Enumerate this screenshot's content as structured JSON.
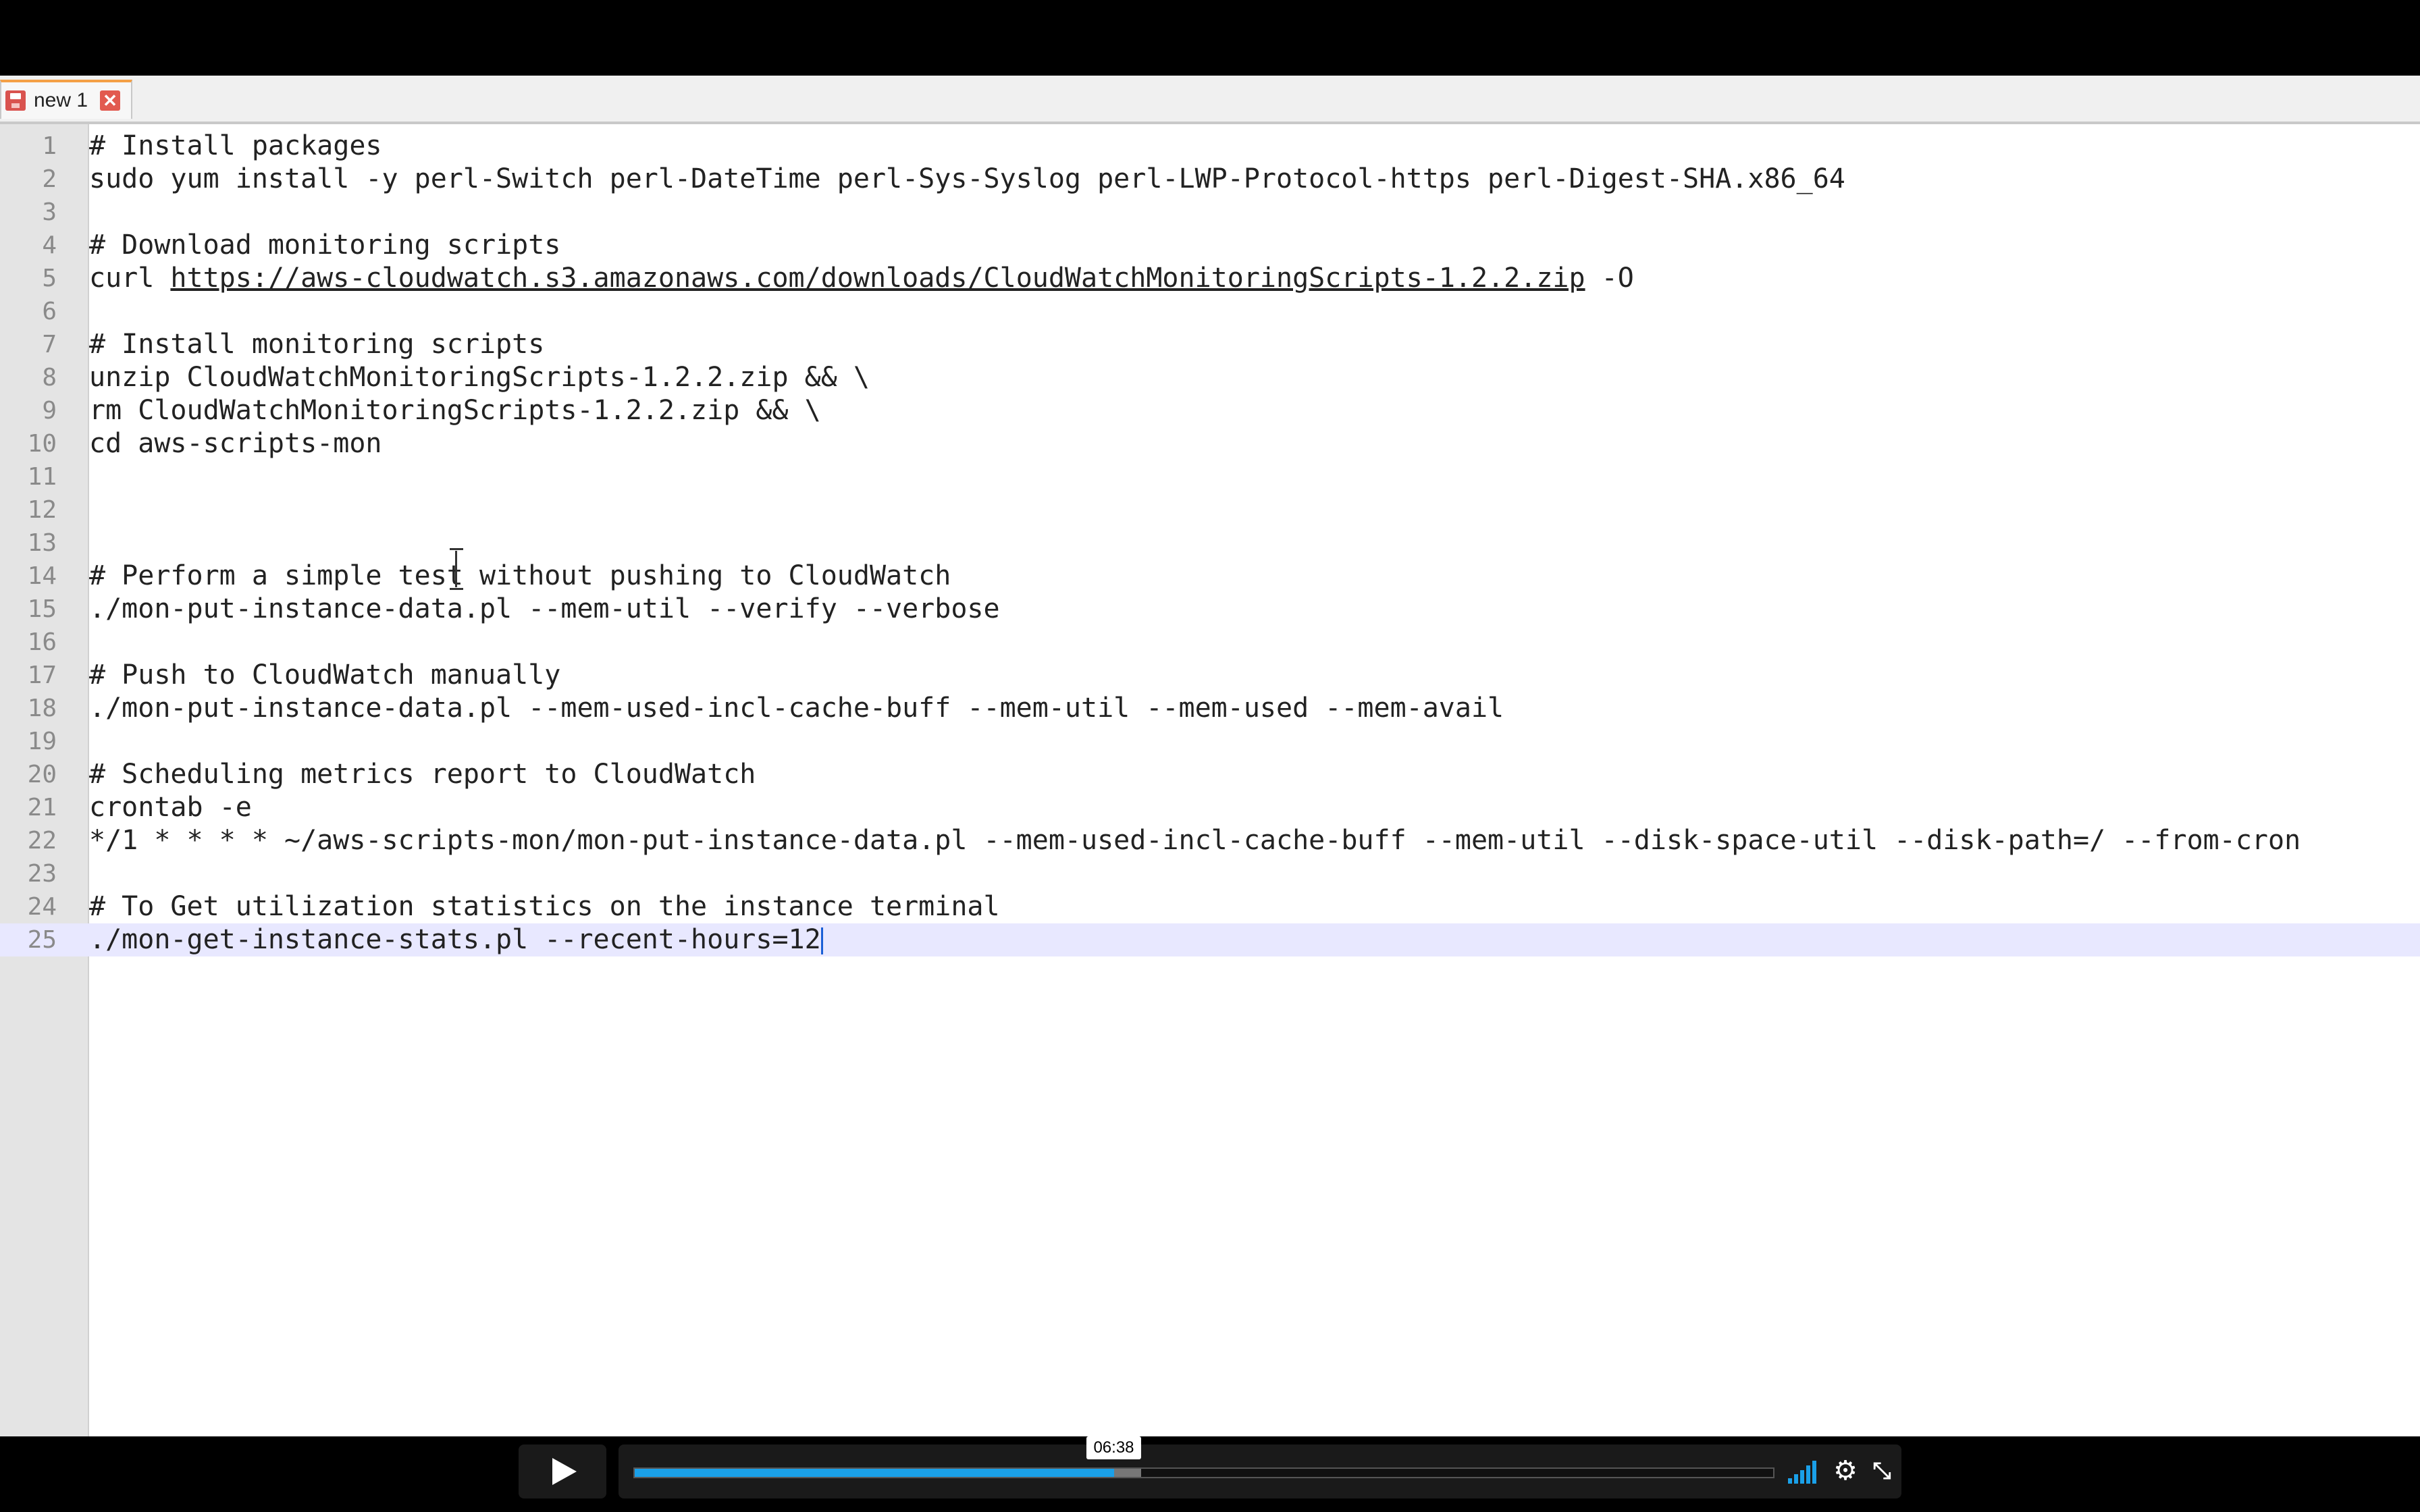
{
  "tab": {
    "label": "new 1",
    "close_glyph": "✕"
  },
  "lines": [
    {
      "num": "1",
      "text": "# Install packages"
    },
    {
      "num": "2",
      "text": "sudo yum install -y perl-Switch perl-DateTime perl-Sys-Syslog perl-LWP-Protocol-https perl-Digest-SHA.x86_64"
    },
    {
      "num": "3",
      "text": ""
    },
    {
      "num": "4",
      "text": "# Download monitoring scripts"
    },
    {
      "num": "5",
      "text": "curl ",
      "link": "https://aws-cloudwatch.s3.amazonaws.com/downloads/CloudWatchMonitoringScripts-1.2.2.zip",
      "after": " -O"
    },
    {
      "num": "6",
      "text": ""
    },
    {
      "num": "7",
      "text": "# Install monitoring scripts"
    },
    {
      "num": "8",
      "text": "unzip CloudWatchMonitoringScripts-1.2.2.zip && \\"
    },
    {
      "num": "9",
      "text": "rm CloudWatchMonitoringScripts-1.2.2.zip && \\"
    },
    {
      "num": "10",
      "text": "cd aws-scripts-mon"
    },
    {
      "num": "11",
      "text": ""
    },
    {
      "num": "12",
      "text": ""
    },
    {
      "num": "13",
      "text": ""
    },
    {
      "num": "14",
      "text": "# Perform a simple test without pushing to CloudWatch"
    },
    {
      "num": "15",
      "text": "./mon-put-instance-data.pl --mem-util --verify --verbose"
    },
    {
      "num": "16",
      "text": ""
    },
    {
      "num": "17",
      "text": "# Push to CloudWatch manually"
    },
    {
      "num": "18",
      "text": "./mon-put-instance-data.pl --mem-used-incl-cache-buff --mem-util --mem-used --mem-avail"
    },
    {
      "num": "19",
      "text": ""
    },
    {
      "num": "20",
      "text": "# Scheduling metrics report to CloudWatch"
    },
    {
      "num": "21",
      "text": "crontab -e"
    },
    {
      "num": "22",
      "text": "*/1 * * * * ~/aws-scripts-mon/mon-put-instance-data.pl --mem-used-incl-cache-buff --mem-util --disk-space-util --disk-path=/ --from-cron"
    },
    {
      "num": "23",
      "text": ""
    },
    {
      "num": "24",
      "text": "# To Get utilization statistics on the instance terminal"
    },
    {
      "num": "25",
      "text": "./mon-get-instance-stats.pl --recent-hours=12",
      "current": true
    }
  ],
  "player": {
    "time": "06:38",
    "progress_fraction": 0.421,
    "buffered_fraction": 0.445,
    "accent_color": "#1aa0e8",
    "icons": [
      "play-icon",
      "volume-icon",
      "gear-icon",
      "fullscreen-icon"
    ]
  }
}
